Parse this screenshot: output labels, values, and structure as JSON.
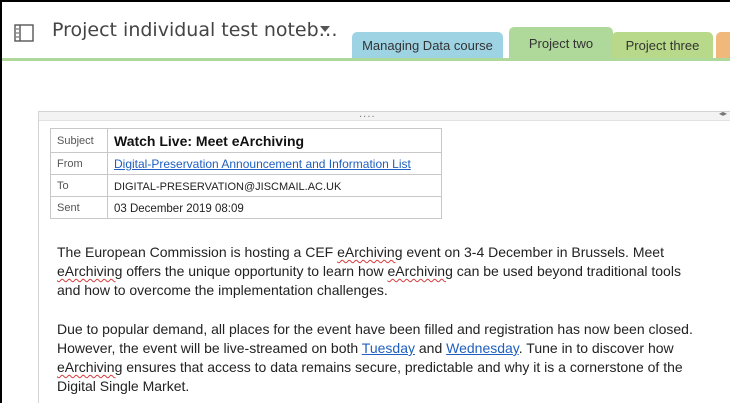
{
  "notebook": {
    "title": "Project individual test noteb…",
    "icon": "notebook-icon"
  },
  "tabs": [
    {
      "label": "Managing Data course",
      "color": "#9ed3e4"
    },
    {
      "label": "Project two",
      "color": "#afd99a",
      "active": true
    },
    {
      "label": "Project three",
      "color": "#b8d98a"
    },
    {
      "label": "",
      "color": "#f0b97b"
    }
  ],
  "email": {
    "subject_label": "Subject",
    "subject": "Watch Live: Meet eArchiving",
    "from_label": "From",
    "from": "Digital-Preservation Announcement and Information List",
    "to_label": "To",
    "to": "DIGITAL-PRESERVATION@JISCMAIL.AC.UK",
    "sent_label": "Sent",
    "sent": "03 December 2019 08:09"
  },
  "handle": "....",
  "body": {
    "p1_line1_a": "The European Commission is hosting a CEF ",
    "p1_line1_b": "eArchiving",
    "p1_line1_c": " event on 3-4 December in Brussels. Meet",
    "p1_line2_a": "eArchiving",
    "p1_line2_b": " offers the unique opportunity to learn how ",
    "p1_line2_c": "eArchiving",
    "p1_line2_d": " can be used beyond traditional tools",
    "p1_line3": "and how to overcome the implementation challenges.",
    "p2_line1": "Due to popular demand, all places for the event have been filled and registration has now been closed.",
    "p2_line2_a": "However, the event will be live-streamed on both ",
    "p2_link1": "Tuesday",
    "p2_line2_b": " and ",
    "p2_link2": "Wednesday",
    "p2_line2_c": ". Tune in to discover how",
    "p2_line3_a": "eArchiving",
    "p2_line3_b": " ensures that access to data remains secure, predictable and why it is a cornerstone of the",
    "p2_line4": "Digital Single Market."
  }
}
